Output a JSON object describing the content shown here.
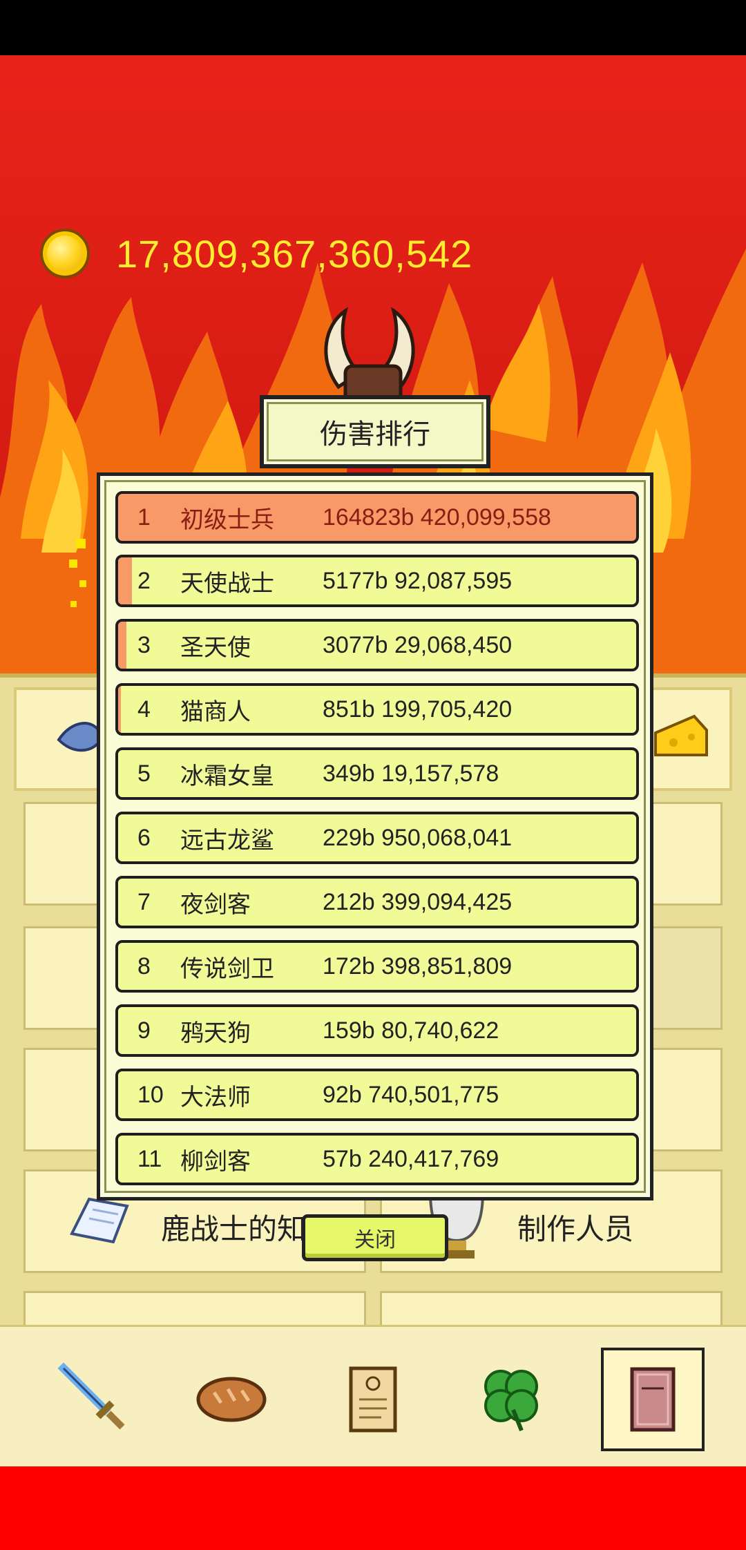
{
  "currency": {
    "icon": "gold-coin-icon",
    "value": "17,809,367,360,542"
  },
  "menu": {
    "card_knowledge": "鹿战士的知识",
    "card_credits": "制作人员"
  },
  "ranking": {
    "title": "伤害排行",
    "rows": [
      {
        "rank": "1",
        "name": "初级士兵",
        "damage": "164823b 420,099,558",
        "progress": 1.0
      },
      {
        "rank": "2",
        "name": "天使战士",
        "damage": "5177b 92,087,595",
        "progress": 0.03
      },
      {
        "rank": "3",
        "name": "圣天使",
        "damage": "3077b 29,068,450",
        "progress": 0.02
      },
      {
        "rank": "4",
        "name": "猫商人",
        "damage": "851b 199,705,420",
        "progress": 0.005
      },
      {
        "rank": "5",
        "name": "冰霜女皇",
        "damage": "349b 19,157,578",
        "progress": 0
      },
      {
        "rank": "6",
        "name": "远古龙鲨",
        "damage": "229b 950,068,041",
        "progress": 0
      },
      {
        "rank": "7",
        "name": "夜剑客",
        "damage": "212b 399,094,425",
        "progress": 0
      },
      {
        "rank": "8",
        "name": "传说剑卫",
        "damage": "172b 398,851,809",
        "progress": 0
      },
      {
        "rank": "9",
        "name": "鸦天狗",
        "damage": "159b 80,740,622",
        "progress": 0
      },
      {
        "rank": "10",
        "name": "大法师",
        "damage": "92b 740,501,775",
        "progress": 0
      },
      {
        "rank": "11",
        "name": "柳剑客",
        "damage": "57b 240,417,769",
        "progress": 0
      }
    ],
    "close_label": "关闭"
  },
  "bottom_nav": [
    {
      "icon": "sword-icon",
      "active": false
    },
    {
      "icon": "bread-icon",
      "active": false
    },
    {
      "icon": "scroll-icon",
      "active": false
    },
    {
      "icon": "clover-icon",
      "active": false
    },
    {
      "icon": "book-icon",
      "active": true
    }
  ],
  "colors": {
    "top_row": "#f79a68",
    "row": "#f0fb97",
    "coin_text": "#ffee2e",
    "sky": "#e8231a"
  }
}
